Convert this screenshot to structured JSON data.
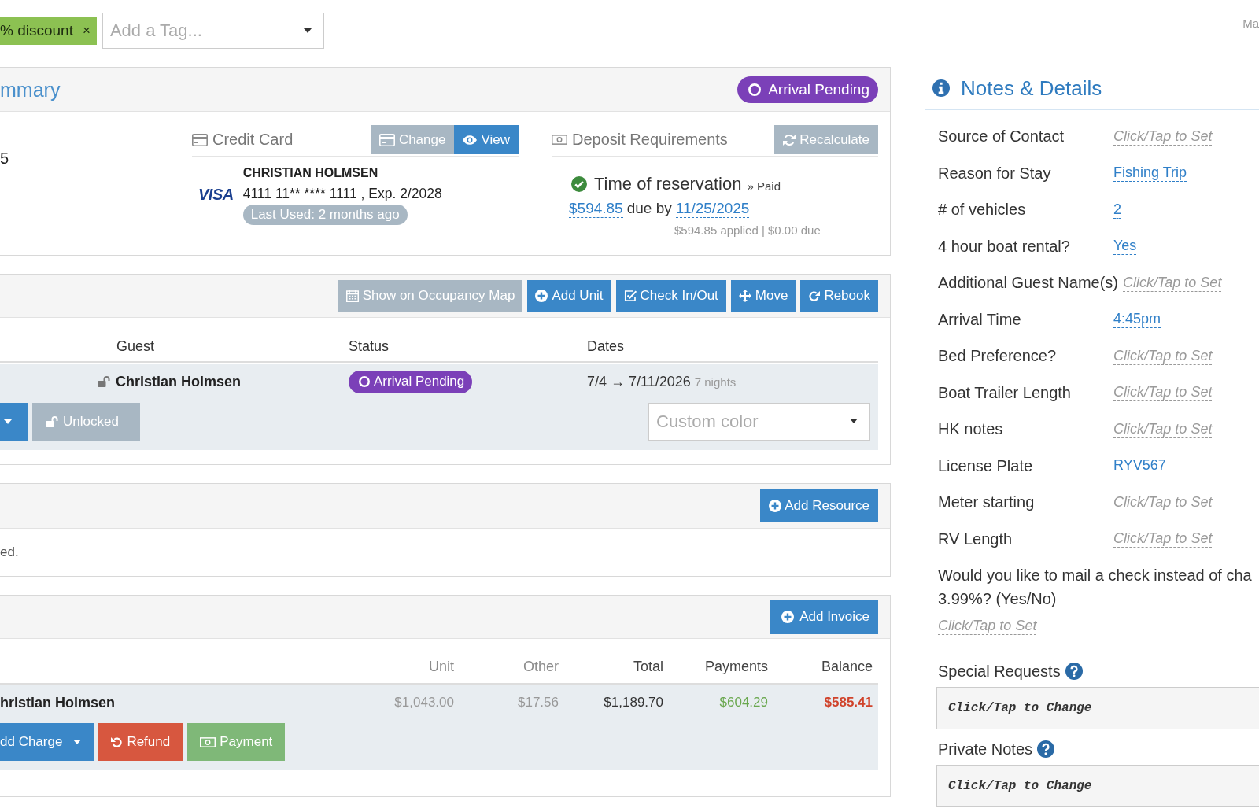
{
  "tags": [
    {
      "label": "% discount",
      "remove": "×"
    }
  ],
  "tag_input": {
    "placeholder": "Add a Tag..."
  },
  "top_right_text": "Ma",
  "summary": {
    "title": "mmary",
    "status": "Arrival Pending",
    "fragment": "5",
    "credit_card": {
      "heading": "Credit Card",
      "buttons": [
        {
          "label": "Change",
          "kind": "secondary"
        },
        {
          "label": "View",
          "kind": "primary"
        }
      ],
      "cardholder": "CHRISTIAN HOLMSEN",
      "brand": "VISA",
      "number": "4111 11** **** 1111 , Exp. 2/2028",
      "last_used": "Last Used: 2 months ago"
    },
    "deposit": {
      "heading": "Deposit Requirements",
      "button": {
        "label": "Recalculate",
        "kind": "secondary"
      },
      "requirements": [
        {
          "name": "Time of reservation",
          "state": "» Paid",
          "paid": true,
          "amount": "$594.85",
          "due_text": "due by",
          "due_date": "11/25/2025",
          "summary": "$594.85 applied | $0.00 due"
        }
      ]
    }
  },
  "units": {
    "toolbar": [
      {
        "label": "Show on Occupancy Map",
        "kind": "secondary"
      },
      {
        "label": "Add Unit",
        "kind": "primary"
      },
      {
        "label": "Check In/Out",
        "kind": "primary"
      },
      {
        "label": "Move",
        "kind": "primary"
      },
      {
        "label": "Rebook",
        "kind": "primary"
      }
    ],
    "columns": [
      "Guest",
      "Status",
      "Dates"
    ],
    "rows": [
      {
        "guest": "Christian Holmsen",
        "locked": false,
        "status": "Arrival Pending",
        "dates": "7/4 → 7/11/2026",
        "nights": "7 nights",
        "lock_button": "Unlocked",
        "color_select": {
          "placeholder": "Custom color"
        }
      }
    ]
  },
  "resources": {
    "button": {
      "label": "Add Resource",
      "kind": "primary"
    },
    "empty_text": "ed."
  },
  "invoices": {
    "button": {
      "label": "Add Invoice",
      "kind": "primary"
    },
    "columns": [
      "Unit",
      "Other",
      "Total",
      "Payments",
      "Balance"
    ],
    "rows": [
      {
        "name": "hristian Holmsen",
        "values": [
          "$1,043.00",
          "$17.56",
          "$1,189.70",
          "$604.29",
          "$585.41"
        ],
        "actions": [
          {
            "label": "dd Charge",
            "kind": "primary",
            "caret": true
          },
          {
            "label": "Refund",
            "kind": "danger",
            "caret": false
          },
          {
            "label": "Payment",
            "kind": "success",
            "caret": false
          }
        ]
      }
    ]
  },
  "notes": {
    "title": "Notes & Details",
    "fields": [
      {
        "kind": "row",
        "label": "Source of Contact",
        "value": "Click/Tap to Set",
        "is_set": false
      },
      {
        "kind": "row",
        "label": "Reason for Stay",
        "value": "Fishing Trip",
        "is_set": true
      },
      {
        "kind": "row",
        "label": "# of vehicles",
        "value": "2",
        "is_set": true
      },
      {
        "kind": "row",
        "label": "4 hour boat rental?",
        "value": "Yes",
        "is_set": true
      },
      {
        "kind": "row",
        "label": "Additional Guest Name(s)",
        "value": "Click/Tap to Set",
        "is_set": false
      },
      {
        "kind": "row",
        "label": "Arrival Time",
        "value": "4:45pm",
        "is_set": true
      },
      {
        "kind": "row",
        "label": "Bed Preference?",
        "value": "Click/Tap to Set",
        "is_set": false
      },
      {
        "kind": "row",
        "label": "Boat Trailer Length",
        "value": "Click/Tap to Set",
        "is_set": false
      },
      {
        "kind": "row",
        "label": "HK notes",
        "value": "Click/Tap to Set",
        "is_set": false
      },
      {
        "kind": "row",
        "label": "License Plate",
        "value": "RYV567",
        "is_set": true
      },
      {
        "kind": "row",
        "label": "Meter starting",
        "value": "Click/Tap to Set",
        "is_set": false
      },
      {
        "kind": "row",
        "label": "RV Length",
        "value": "Click/Tap to Set",
        "is_set": false
      },
      {
        "kind": "block",
        "label_lines": [
          "Would you like to mail a check instead of cha",
          "3.99%? (Yes/No)"
        ],
        "value": "Click/Tap to Set",
        "is_set": false
      }
    ],
    "text_areas": [
      {
        "label": "Special Requests",
        "value": "Click/Tap to Change"
      },
      {
        "label": "Private Notes",
        "value": "Click/Tap to Change"
      }
    ]
  }
}
